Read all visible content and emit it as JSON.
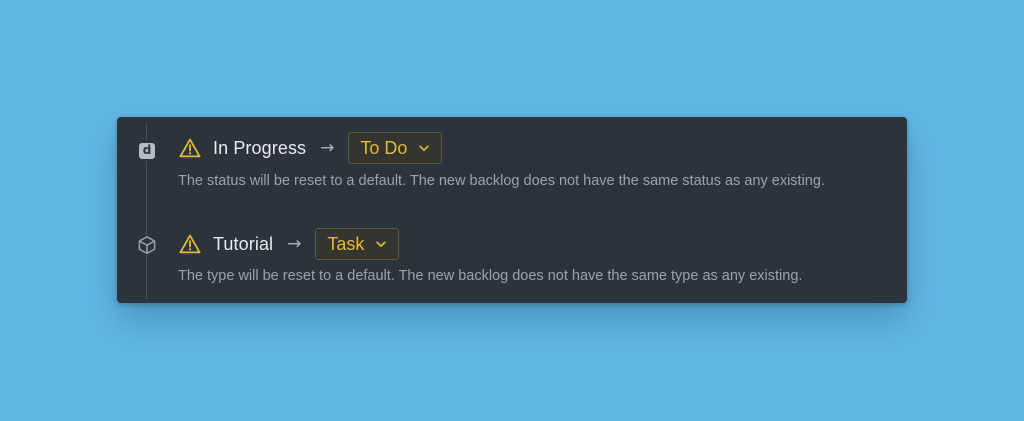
{
  "colors": {
    "background": "#62b8e5",
    "panel": "#2d333b",
    "warning": "#e2b93d",
    "text": "#e7eaee",
    "muted": "#9aa2ab"
  },
  "changes": [
    {
      "node_icon": "status-badge-icon",
      "node_letter": "d",
      "warning_icon": "warning-icon",
      "from": "In Progress",
      "arrow": "→",
      "to": "To Do",
      "description": "The status will be reset to a default. The new backlog does not have the same status as any existing."
    },
    {
      "node_icon": "cube-icon",
      "warning_icon": "warning-icon",
      "from": "Tutorial",
      "arrow": "→",
      "to": "Task",
      "description": "The type will be reset to a default. The new backlog does not have the same type as any existing."
    }
  ]
}
